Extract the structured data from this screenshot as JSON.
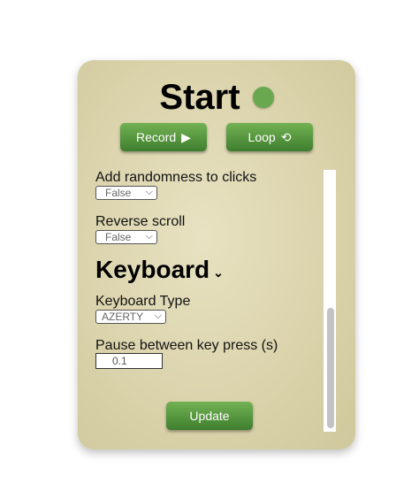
{
  "header": {
    "title": "Start",
    "status_color": "#6aa84f"
  },
  "toolbar": {
    "record_label": "Record",
    "record_icon": "play-icon",
    "loop_label": "Loop",
    "loop_icon": "loop-icon"
  },
  "settings": {
    "randomness": {
      "label": "Add randomness to clicks",
      "value": "False"
    },
    "reverse_scroll": {
      "label": "Reverse scroll",
      "value": "False"
    }
  },
  "keyboard": {
    "section_title": "Keyboard",
    "type_label": "Keyboard Type",
    "type_value": "AZERTY",
    "pause_label": "Pause between key press (s)",
    "pause_value": "0.1"
  },
  "footer": {
    "update_label": "Update"
  },
  "colors": {
    "button_green": "#4f8f3a",
    "panel_beige": "#ddd6b0"
  }
}
